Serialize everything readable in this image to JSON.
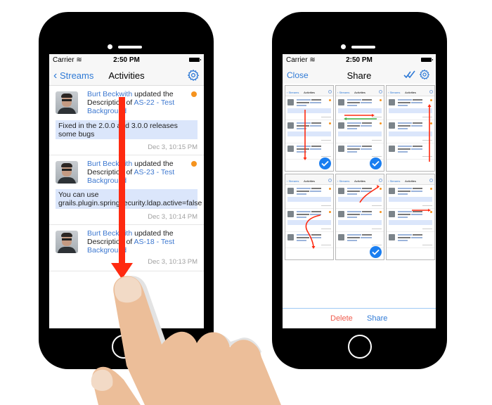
{
  "left_phone": {
    "status_bar": {
      "carrier": "Carrier",
      "time": "2:50 PM"
    },
    "nav": {
      "back_label": "Streams",
      "title": "Activities",
      "settings_icon": "gear-icon"
    },
    "activities": [
      {
        "author": "Burt Beckwith",
        "action": " updated the Description of ",
        "issue": "AS-22 - Test Background",
        "unread": true,
        "comment": "Fixed in the 2.0.0 and 3.0.0 releases some bugs",
        "timestamp": "Dec 3, 10:15 PM"
      },
      {
        "author": "Burt Beckwith",
        "action": " updated the Description of ",
        "issue": "AS-23 - Test Background",
        "unread": true,
        "comment": "You can use grails.plugin.springsecurity.ldap.active=false",
        "timestamp": "Dec 3, 10:14 PM"
      },
      {
        "author": "Burt Beckwith",
        "action": " updated the Description of ",
        "issue": "AS-18 - Test Background",
        "unread": false,
        "comment": "",
        "timestamp": "Dec 3, 10:13 PM"
      }
    ],
    "gesture": "swipe-down"
  },
  "right_phone": {
    "status_bar": {
      "carrier": "Carrier",
      "time": "2:50 PM"
    },
    "nav": {
      "close_label": "Close",
      "title": "Share",
      "select_all_icon": "double-check-icon",
      "settings_icon": "gear-icon"
    },
    "thumbnail_title": "Activities",
    "thumbnail_back": "Streams",
    "thumbnails": [
      {
        "selected": true,
        "gesture": "vertical-swipe"
      },
      {
        "selected": true,
        "gesture": "horizontal-swipes"
      },
      {
        "selected": false,
        "gesture": "long-vertical-swipe"
      },
      {
        "selected": false,
        "gesture": "curvy-swipe"
      },
      {
        "selected": true,
        "gesture": "diagonal-swipe"
      },
      {
        "selected": false,
        "gesture": "short-horizontal-swipe"
      }
    ],
    "toolbar": {
      "delete_label": "Delete",
      "share_label": "Share"
    }
  },
  "colors": {
    "accent": "#2f7ad6",
    "unread_dot": "#f5931e",
    "gesture_arrow": "#ff2a10",
    "gesture_green": "#3cb043",
    "delete": "#f05c4e",
    "skin": "#ecbe99"
  }
}
